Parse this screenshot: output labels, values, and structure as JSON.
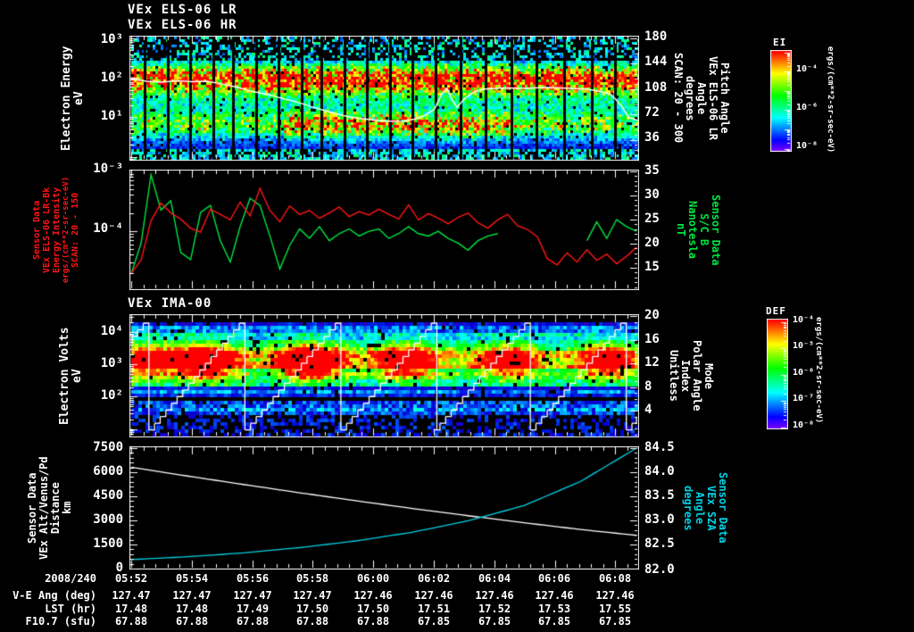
{
  "window": {
    "background": "#000000"
  },
  "colors": {
    "red": "#ff1515",
    "green": "#00e640",
    "cyan": "#00d2e6",
    "white": "#ffffff"
  },
  "panel1": {
    "title_line1": "VEx ELS-06 LR",
    "title_line2": "VEx ELS-06 HR",
    "left_label_lines": [
      "Electron Energy",
      "eV"
    ],
    "left_ticks": [
      "10³",
      "10²",
      "10¹"
    ],
    "right_ticks": [
      "180",
      "144",
      "108",
      "72",
      "36"
    ],
    "right_label_lines": [
      "Pitch Angle",
      "VEx ELS-06 LR",
      "Angle",
      "degrees",
      "SCAN: 20 - 300"
    ],
    "colorbar": {
      "title": "EI",
      "ticks": [
        "10⁻⁴",
        "10⁻⁶",
        "10⁻⁸"
      ],
      "units": "ergs/(cm**2-sr-sec-eV)"
    }
  },
  "panel2": {
    "left_ticks": [
      "10⁻³",
      "10⁻⁴"
    ],
    "left_label_lines": [
      "Sensor Data",
      "VEx ELS-06 LR-Bk",
      "Energy Intensity",
      "ergs/(cm**2-sr-sec-eV)",
      "SCAN: 20 - 150"
    ],
    "right_ticks": [
      "35",
      "30",
      "25",
      "20",
      "15"
    ],
    "right_label_lines": [
      "Sensor Data",
      "S/C B",
      "Nanotesla",
      "nT"
    ]
  },
  "panel3": {
    "title": "VEx IMA-00",
    "left_label_lines": [
      "Electron Volts",
      "eV"
    ],
    "left_ticks": [
      "10⁴",
      "10³",
      "10²"
    ],
    "right_ticks": [
      "20",
      "16",
      "12",
      "8",
      "4"
    ],
    "right_label_lines": [
      "Mode",
      "Polar Angle",
      "Index",
      "Unitless"
    ],
    "colorbar": {
      "title": "DEF",
      "ticks": [
        "10⁻⁴",
        "10⁻⁵",
        "10⁻⁶",
        "10⁻⁷",
        "10⁻⁸"
      ],
      "units": "ergs/(cm**2-sr-sec-eV)"
    }
  },
  "panel4": {
    "left_ticks": [
      "7500",
      "6000",
      "4500",
      "3000",
      "1500",
      "0"
    ],
    "left_label_lines": [
      "Sensor Data",
      "VEx Alt/Venus/Pd",
      "Distance",
      "km"
    ],
    "right_ticks": [
      "84.5",
      "84.0",
      "83.5",
      "83.0",
      "82.5",
      "82.0"
    ],
    "right_label_lines": [
      "Sensor Data",
      "VEx SZA",
      "Angle",
      "degrees"
    ]
  },
  "time_axis": {
    "date": "2008/240",
    "times": [
      "05:52",
      "05:54",
      "05:56",
      "05:58",
      "06:00",
      "06:02",
      "06:04",
      "06:06",
      "06:08"
    ]
  },
  "ephemeris": {
    "rows": [
      {
        "label": "V-E Ang (deg)",
        "values": [
          "127.47",
          "127.47",
          "127.47",
          "127.47",
          "127.46",
          "127.46",
          "127.46",
          "127.46",
          "127.46"
        ]
      },
      {
        "label": "LST (hr)",
        "values": [
          "17.48",
          "17.48",
          "17.49",
          "17.50",
          "17.50",
          "17.51",
          "17.52",
          "17.53",
          "17.55"
        ]
      },
      {
        "label": "F10.7 (sfu)",
        "values": [
          "67.88",
          "67.88",
          "67.88",
          "67.88",
          "67.88",
          "67.85",
          "67.85",
          "67.85",
          "67.85"
        ]
      }
    ]
  },
  "chart_data": [
    {
      "id": "els_pitch_angle_spectrogram",
      "type": "heatmap",
      "title": "VEx ELS-06 LR / VEx ELS-06 HR",
      "x_range": [
        "05:52",
        "06:08"
      ],
      "x_tick_interval_min": 2,
      "ylabel": "Electron Energy (eV)",
      "y_scale": "log",
      "y_range_ev": [
        0.8,
        1120
      ],
      "right_axis": {
        "label": "Pitch Angle, degrees, SCAN: 20 - 300",
        "ticks": [
          180,
          144,
          108,
          72,
          36
        ]
      },
      "colorbar": {
        "title": "EI",
        "units": "ergs/(cm**2-sr-sec-eV)",
        "tick_values": [
          0.0001,
          1e-06,
          1e-08
        ]
      },
      "bands": {
        "main_band_center_ev": 100,
        "low_band_center_ev": 7,
        "low_band_strong_frac": [
          0.3,
          0.75
        ]
      },
      "gap_fracs": [
        0.025,
        0.07,
        0.115,
        0.16,
        0.2,
        0.245,
        0.29,
        0.335,
        0.375,
        0.42,
        0.465,
        0.51,
        0.555,
        0.6,
        0.65,
        0.7,
        0.75,
        0.8,
        0.855,
        0.91,
        0.955
      ],
      "overlay_mean_energy_ev": [
        [
          0.0,
          95
        ],
        [
          0.03,
          82
        ],
        [
          0.06,
          78
        ],
        [
          0.09,
          85
        ],
        [
          0.12,
          80
        ],
        [
          0.15,
          82
        ],
        [
          0.18,
          70
        ],
        [
          0.21,
          58
        ],
        [
          0.24,
          45
        ],
        [
          0.27,
          38
        ],
        [
          0.3,
          30
        ],
        [
          0.33,
          24
        ],
        [
          0.36,
          18
        ],
        [
          0.39,
          14
        ],
        [
          0.42,
          11
        ],
        [
          0.45,
          9.5
        ],
        [
          0.48,
          8.5
        ],
        [
          0.51,
          8
        ],
        [
          0.54,
          8
        ],
        [
          0.56,
          9
        ],
        [
          0.58,
          11
        ],
        [
          0.6,
          16
        ],
        [
          0.615,
          40
        ],
        [
          0.625,
          55
        ],
        [
          0.635,
          28
        ],
        [
          0.645,
          18
        ],
        [
          0.66,
          30
        ],
        [
          0.68,
          45
        ],
        [
          0.7,
          52
        ],
        [
          0.74,
          56
        ],
        [
          0.78,
          54
        ],
        [
          0.82,
          57
        ],
        [
          0.86,
          55
        ],
        [
          0.9,
          52
        ],
        [
          0.93,
          45
        ],
        [
          0.95,
          38
        ],
        [
          0.97,
          20
        ],
        [
          0.985,
          10
        ],
        [
          1.0,
          8.5
        ]
      ]
    },
    {
      "id": "els_intensity_and_bfield",
      "type": "line",
      "x_range": [
        "05:52",
        "06:08"
      ],
      "series": [
        {
          "name": "VEx ELS-06 LR-Bk Energy Intensity, SCAN: 20 - 150",
          "units": "ergs/(cm**2-sr-sec-eV)",
          "color": "#ff1515",
          "axis": "left",
          "scale": "log",
          "range": [
            1e-05,
            0.001
          ],
          "values": [
            1.8e-05,
            3e-05,
            0.00014,
            0.00028,
            0.00019,
            0.00015,
            0.000105,
            9e-05,
            0.00022,
            0.00018,
            0.000145,
            0.00029,
            0.00017,
            0.0005,
            0.00021,
            0.000135,
            0.00025,
            0.00018,
            0.00021,
            0.000155,
            0.00019,
            0.00024,
            0.000165,
            0.0002,
            0.000175,
            0.00022,
            0.00018,
            0.00015,
            0.00026,
            0.000145,
            0.000185,
            0.000155,
            0.000125,
            0.00016,
            0.00019,
            0.00013,
            0.000105,
            0.000145,
            0.00018,
            0.000115,
            0.0001,
            7.5e-05,
            3.2e-05,
            2.5e-05,
            4e-05,
            2.8e-05,
            4.5e-05,
            3e-05,
            3.8e-05,
            2.6e-05,
            3.5e-05,
            5e-05
          ]
        },
        {
          "name": "S/C B",
          "units": "nT",
          "color": "#00e640",
          "axis": "right",
          "scale": "linear",
          "range": [
            10.4,
            35.4
          ],
          "values": [
            13.5,
            20,
            34.5,
            27,
            29,
            18,
            16.5,
            26.5,
            28,
            20.5,
            16,
            23.5,
            29.5,
            28,
            21.5,
            14.5,
            19.5,
            23,
            21,
            23.5,
            20.5,
            22,
            23,
            21.5,
            22.5,
            23,
            21,
            22,
            23.5,
            22,
            21.5,
            22.5,
            21,
            20,
            18.5,
            20.5,
            21.5,
            22,
            null,
            null,
            null,
            null,
            null,
            null,
            null,
            null,
            20.5,
            24.5,
            21,
            25,
            23.5,
            22.5
          ]
        }
      ]
    },
    {
      "id": "ima_spectrogram",
      "type": "heatmap",
      "title": "VEx IMA-00",
      "ylabel": "Electron Volts (eV)",
      "y_scale": "log",
      "y_range_ev": [
        4,
        33000
      ],
      "right_axis": {
        "label": "Mode / Polar Angle Index (Unitless)",
        "ticks": [
          20,
          16,
          12,
          8,
          4
        ]
      },
      "colorbar": {
        "title": "DEF",
        "units": "ergs/(cm**2-sr-sec-eV)",
        "tick_values": [
          0.0001,
          1e-05,
          1e-06,
          1e-07,
          1e-08
        ]
      },
      "blob_centers_frac": [
        0.005,
        0.145,
        0.35,
        0.545,
        0.745,
        0.945
      ],
      "blob_amps": [
        0.7,
        0.95,
        1.0,
        0.85,
        0.8,
        0.85
      ],
      "blob_center_ev": 1000,
      "overlay": {
        "name": "Polar Angle Index staircase",
        "ramp_drop_fracs": [
          0.035,
          0.225,
          0.415,
          0.6,
          0.79,
          0.98
        ],
        "index_range": [
          1,
          19
        ],
        "steps": 16
      }
    },
    {
      "id": "altitude_and_sza",
      "type": "line",
      "x_range": [
        "05:52",
        "06:08"
      ],
      "series": [
        {
          "name": "VEx Alt/Venus/Pd Distance",
          "units": "km",
          "color": "#ffffff",
          "axis": "left",
          "scale": "linear",
          "range": [
            0,
            7500
          ],
          "values": [
            6300,
            5750,
            5220,
            4700,
            4200,
            3720,
            3260,
            2820,
            2400,
            2030
          ]
        },
        {
          "name": "VEx SZA Angle",
          "units": "degrees",
          "color": "#00d2e6",
          "axis": "right",
          "scale": "linear",
          "range": [
            82.0,
            84.5
          ],
          "values": [
            82.17,
            82.23,
            82.31,
            82.42,
            82.56,
            82.74,
            82.98,
            83.3,
            83.8,
            84.5
          ]
        }
      ]
    }
  ]
}
